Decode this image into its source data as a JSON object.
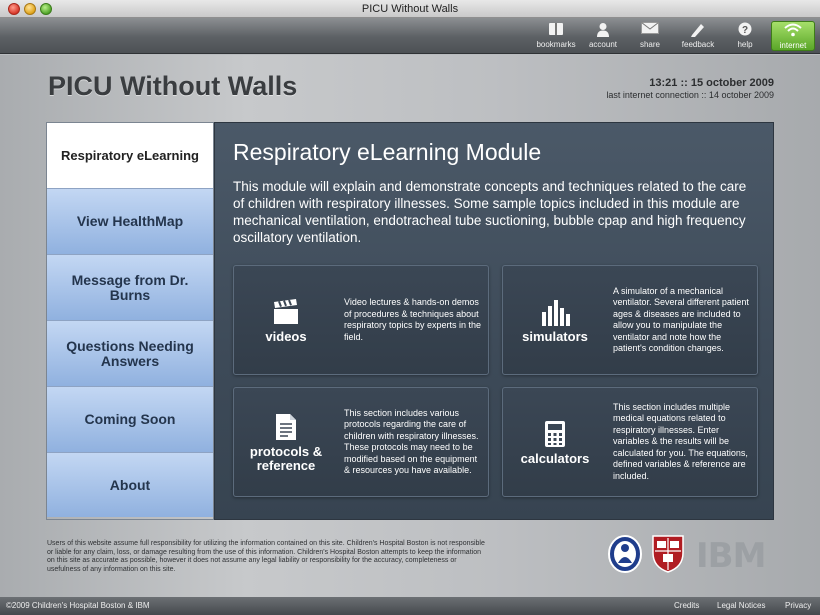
{
  "window": {
    "title": "PICU Without Walls"
  },
  "toolbar": {
    "buttons": [
      {
        "label": "bookmarks",
        "icon": "bookmarks-icon"
      },
      {
        "label": "account",
        "icon": "account-icon"
      },
      {
        "label": "share",
        "icon": "envelope-icon"
      },
      {
        "label": "feedback",
        "icon": "feedback-icon"
      },
      {
        "label": "help",
        "icon": "help-icon"
      }
    ],
    "internet": {
      "label": "internet",
      "icon": "wifi-icon",
      "color": "#5aa628"
    }
  },
  "header": {
    "app_title": "PICU Without Walls",
    "datetime": "13:21 :: 15 october 2009",
    "last_connection": "last internet connection :: 14 october 2009"
  },
  "sidebar": {
    "items": [
      {
        "label": "Respiratory eLearning",
        "active": true
      },
      {
        "label": "View HealthMap"
      },
      {
        "label": "Message from Dr. Burns"
      },
      {
        "label": "Questions Needing Answers"
      },
      {
        "label": "Coming Soon"
      },
      {
        "label": "About"
      }
    ]
  },
  "main": {
    "title": "Respiratory eLearning Module",
    "intro": "This module will explain and demonstrate concepts and techniques related to the care of children with respiratory illnesses. Some sample topics included in this module are mechanical ventilation, endotracheal tube suctioning, bubble cpap and high frequency oscillatory ventilation.",
    "cards": [
      {
        "label": "videos",
        "icon": "clapperboard-icon",
        "description": "Video lectures & hands-on demos of procedures & techniques about respiratory topics by experts in the field."
      },
      {
        "label": "simulators",
        "icon": "bar-chart-icon",
        "description": "A simulator of a mechanical ventilator. Several different patient ages & diseases are included to allow you to manipulate the ventilator and note how the patient's condition changes."
      },
      {
        "label": "protocols & reference",
        "icon": "document-icon",
        "description": "This section includes various protocols regarding the care of children with respiratory illnesses. These protocols may need to be modified based on the equipment & resources you have available."
      },
      {
        "label": "calculators",
        "icon": "calculator-icon",
        "description": "This section includes multiple medical equations related to respiratory illnesses. Enter variables & the results will be calculated for you. The equations, defined variables & reference are included."
      }
    ]
  },
  "footer": {
    "disclaimer": "Users of this website assume full responsibility for utilizing the information contained on this site. Children's Hospital Boston is not responsible or liable for any claim, loss, or damage resulting from the use of this information. Children's Hospital Boston attempts to keep the information on this site as accurate as possible, however it does not assume any legal liability or responsibility for the accuracy, completeness or usefulness of any information on this site.",
    "logos": [
      "childrens-hospital-logo",
      "harvard-shield-logo",
      "ibm-logo"
    ],
    "ibm_text": "IBM",
    "copyright": "©2009 Children's Hospital Boston & IBM",
    "links": [
      "Credits",
      "Legal Notices",
      "Privacy"
    ]
  }
}
